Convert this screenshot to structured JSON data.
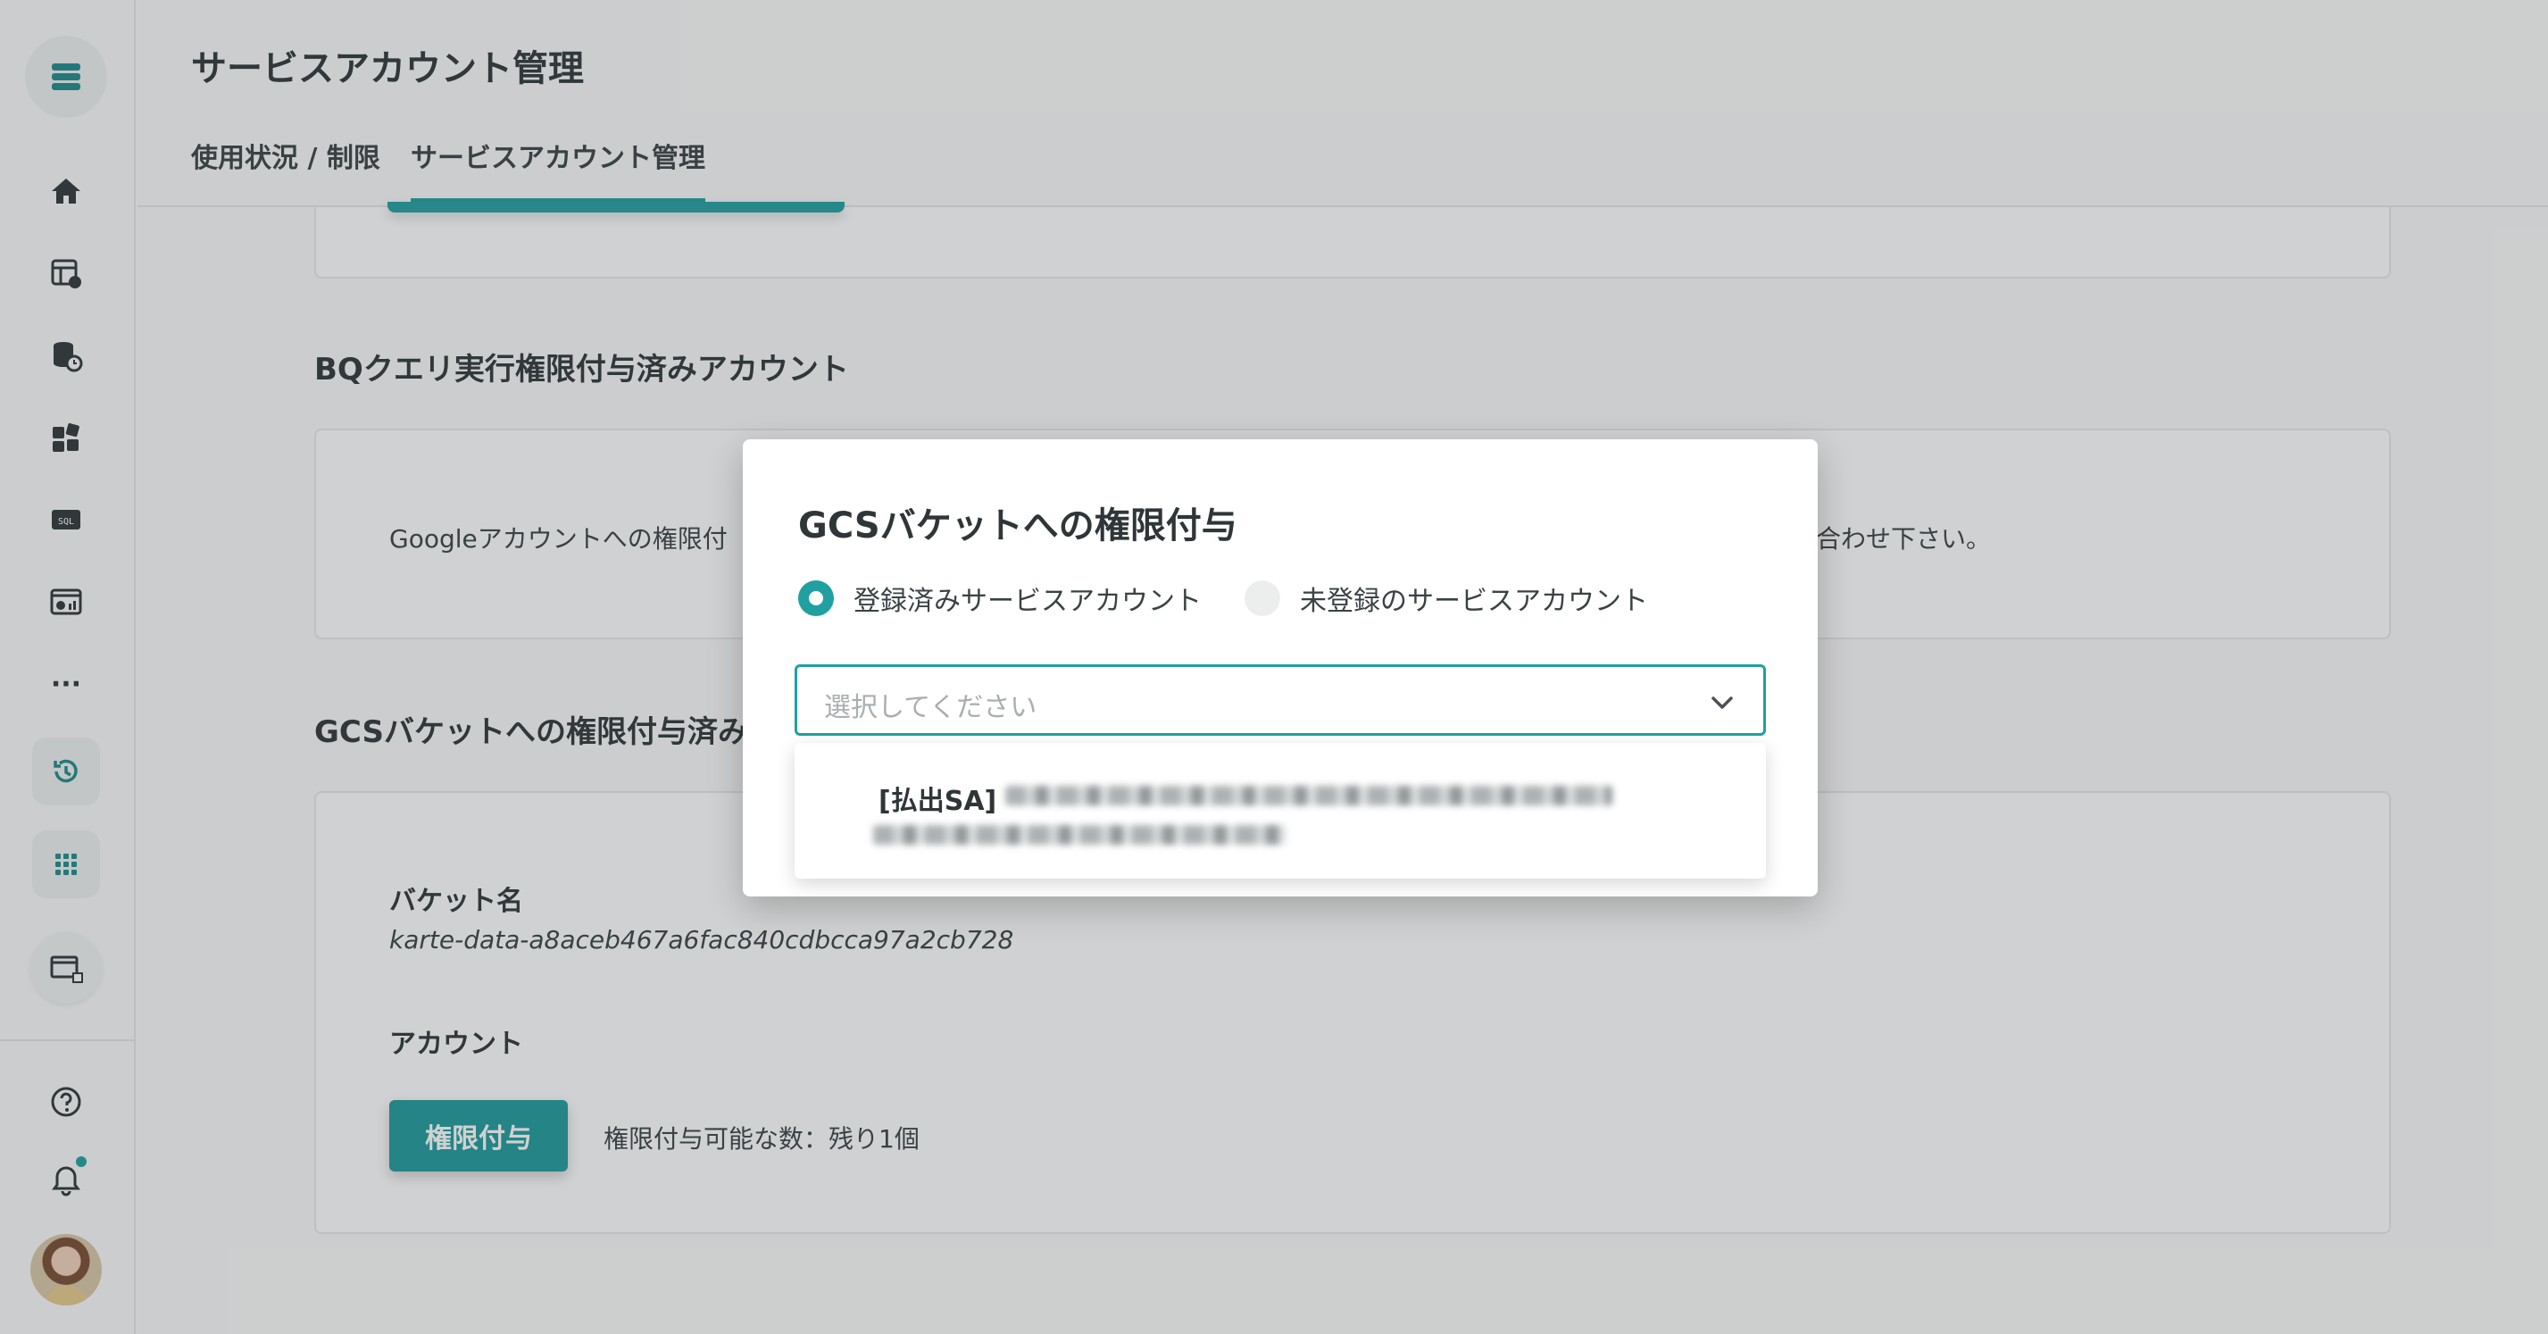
{
  "page": {
    "title": "サービスアカウント管理",
    "tabs": [
      {
        "label": "使用状況 / 制限",
        "active": false
      },
      {
        "label": "サービスアカウント管理",
        "active": true
      }
    ]
  },
  "sidebar": {
    "icons": [
      "menu-logo-icon",
      "home-icon",
      "table-icon",
      "database-clock-icon",
      "blocks-icon",
      "sql-icon",
      "dashboard-icon",
      "more-icon",
      "history-icon",
      "apps-grid-icon",
      "window-icon",
      "help-icon",
      "bell-icon",
      "avatar"
    ],
    "more_label": "···",
    "sql_label": "SQL"
  },
  "sections": {
    "bq": {
      "title": "BQクエリ実行権限付与済みアカウント",
      "text": "Googleアカウントへの権限付",
      "text_tail": "合わせ下さい。"
    },
    "gcs": {
      "title": "GCSバケットへの権限付与済み",
      "bucket_label": "バケット名",
      "bucket_name": "karte-data-a8aceb467a6fac840cdbcca97a2cb728",
      "account_label": "アカウント",
      "grant_button": "権限付与",
      "remaining": "権限付与可能な数：残り1個"
    }
  },
  "modal": {
    "title": "GCSバケットへの権限付与",
    "radio_registered": "登録済みサービスアカウント",
    "radio_unregistered": "未登録のサービスアカウント",
    "selected_option": "registered",
    "select_placeholder": "選択してください",
    "options": [
      {
        "prefix": "[払出SA]"
      }
    ]
  },
  "colors": {
    "accent": "#20a0a0",
    "text": "#2f3638",
    "placeholder": "#a9aeb0"
  }
}
